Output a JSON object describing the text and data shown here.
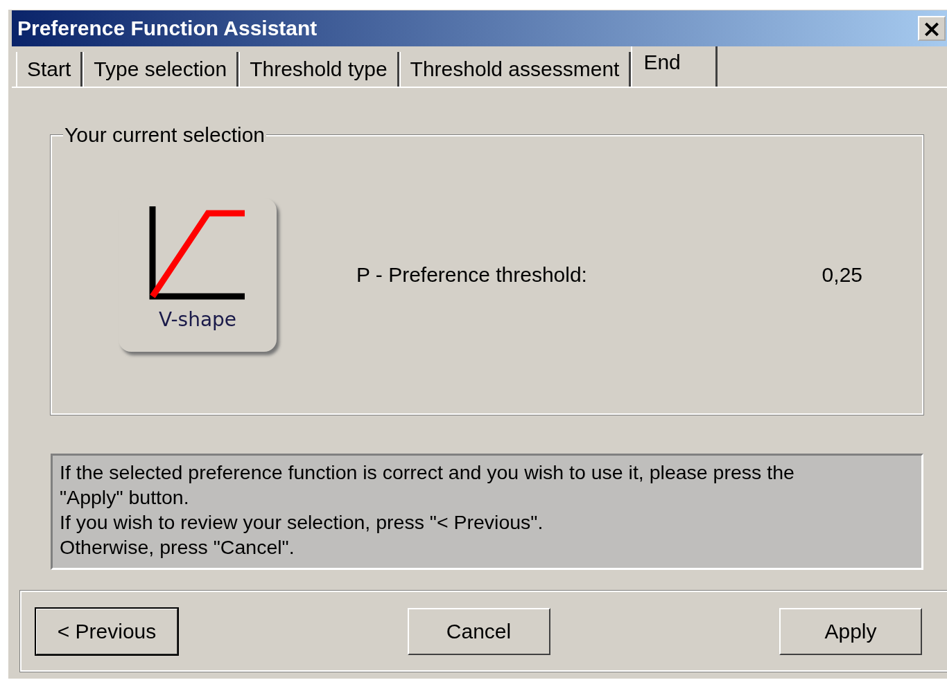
{
  "window": {
    "title": "Preference Function Assistant",
    "close": "×"
  },
  "tabs": [
    {
      "label": "Start",
      "selected": false
    },
    {
      "label": "Type selection",
      "selected": false
    },
    {
      "label": "Threshold type",
      "selected": false
    },
    {
      "label": "Threshold assessment",
      "selected": false
    },
    {
      "label": "End",
      "selected": true
    }
  ],
  "selection_group": {
    "title": "Your current selection",
    "function": {
      "label": "V-shape"
    },
    "threshold": {
      "label": "P - Preference threshold:",
      "value": "0,25"
    }
  },
  "message": "If the selected preference function is correct and you wish to use it, please press the\n\"Apply\" button.\nIf you wish to review your selection, press \"< Previous\".\nOtherwise, press \"Cancel\".",
  "buttons": [
    {
      "label": "< Previous",
      "default": true
    },
    {
      "label": "Cancel",
      "default": false
    },
    {
      "label": "Apply",
      "default": false
    }
  ]
}
